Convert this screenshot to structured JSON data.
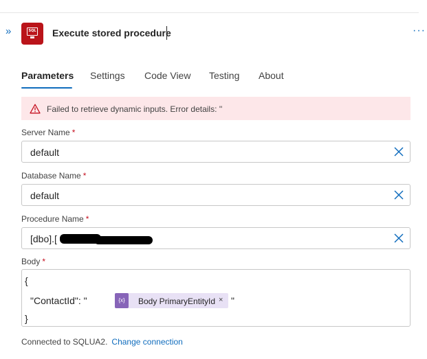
{
  "header": {
    "title": "Execute stored procedure",
    "expand_icon": "chevron-double-right-icon",
    "connector_icon": "sql-monitor-icon",
    "connector_icon_text": "SQL",
    "more_icon": "more-horizontal-icon",
    "brand_color": "#ba141a"
  },
  "tabs": [
    {
      "label": "Parameters",
      "active": true
    },
    {
      "label": "Settings",
      "active": false
    },
    {
      "label": "Code View",
      "active": false
    },
    {
      "label": "Testing",
      "active": false
    },
    {
      "label": "About",
      "active": false
    }
  ],
  "error": {
    "icon": "warning-icon",
    "message": "Failed to retrieve dynamic inputs. Error details: ''"
  },
  "fields": {
    "server": {
      "label": "Server Name",
      "required_mark": "*",
      "value": "default"
    },
    "database": {
      "label": "Database Name",
      "required_mark": "*",
      "value": "default"
    },
    "procedure": {
      "label": "Procedure Name",
      "required_mark": "*",
      "value": "[dbo].[",
      "redacted": true
    }
  },
  "body": {
    "label": "Body",
    "required_mark": "*",
    "line1": "{",
    "line2_prefix": "\"ContactId\": \"",
    "token_icon": "{x}",
    "token_label": "Body PrimaryEntityId",
    "token_close": "×",
    "line2_suffix": "\"",
    "line3": "}"
  },
  "footer": {
    "connected_text": "Connected to SQLUA2.",
    "change_link": "Change connection"
  }
}
